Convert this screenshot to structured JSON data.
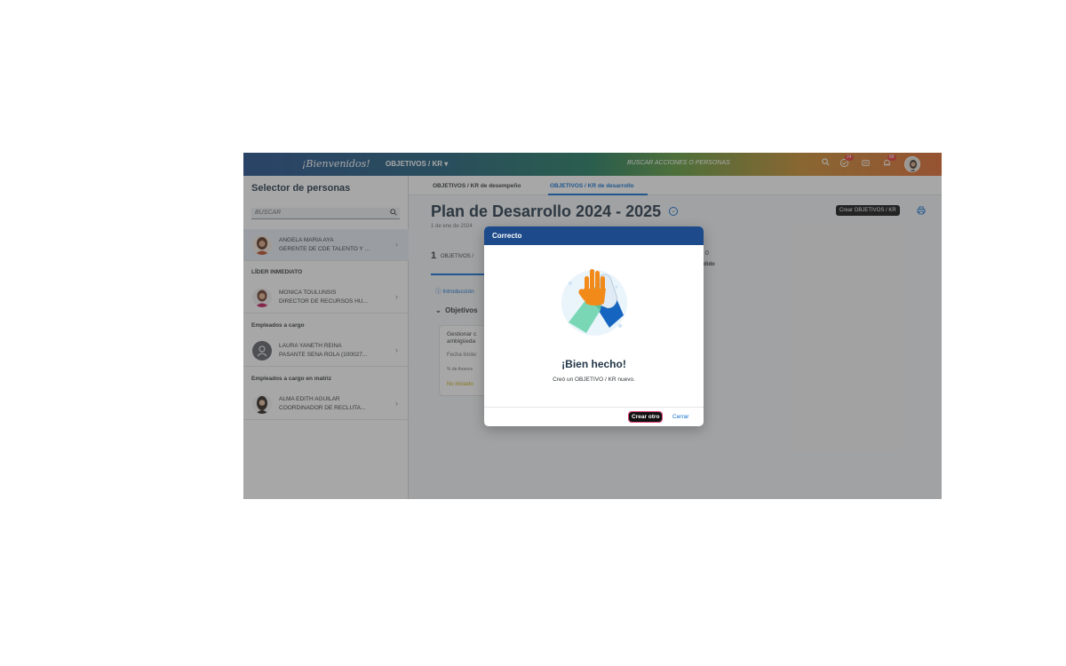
{
  "header": {
    "logo_text": "¡Bienvenidos!",
    "menu_label": "OBJETIVOS / KR ▾",
    "search_placeholder": "BUSCAR ACCIONES O PERSONAS",
    "badge_1": "24",
    "badge_2": "88"
  },
  "sidebar": {
    "title": "Selector de personas",
    "search_placeholder": "BUSCAR",
    "selected_person": {
      "name": "ANGELA MARIA AYA",
      "role": "GERENTE DE CDE TALENTO Y ..."
    },
    "sections": [
      {
        "label": "LÍDER INMEDIATO",
        "person": {
          "name": "MONICA TOULUNSIS",
          "role": "DIRECTOR DE RECURSOS HU..."
        }
      },
      {
        "label": "Empleados a cargo",
        "person": {
          "name": "LAURA YANETH REINA",
          "role": "PASANTE SENA ROLA (100027..."
        }
      },
      {
        "label": "Empleados a cargo en matriz",
        "person": {
          "name": "ALMA EDITH AGUILAR",
          "role": "COORDINADOR DE RECLUTA..."
        }
      }
    ]
  },
  "main": {
    "tabs": [
      "OBJETIVOS / KR de desempeño",
      "OBJETIVOS / KR de desarrollo"
    ],
    "title": "Plan de Desarrollo 2024 - 2025",
    "date_range": "1 de ene de 2024",
    "create_button": "Crear OBJETIVOS / KR",
    "stats_count": "1",
    "stats_label": "OBJETIVOS /",
    "stats_zero": "0",
    "stats_right_label": "endido",
    "intro_link": "Introducción",
    "objectives_header": "Objetivos",
    "card": {
      "line1": "Gestionar c",
      "line2": "ambigüeda",
      "date": "Fecha límite:",
      "progress_label": "% de Avance",
      "status": "No iniciado"
    }
  },
  "dialog": {
    "title": "Correcto",
    "heading": "¡Bien hecho!",
    "message": "Creó un OBJETIVO / KR nuevo.",
    "primary_button": "Crear otro",
    "secondary_button": "Cerrar"
  }
}
